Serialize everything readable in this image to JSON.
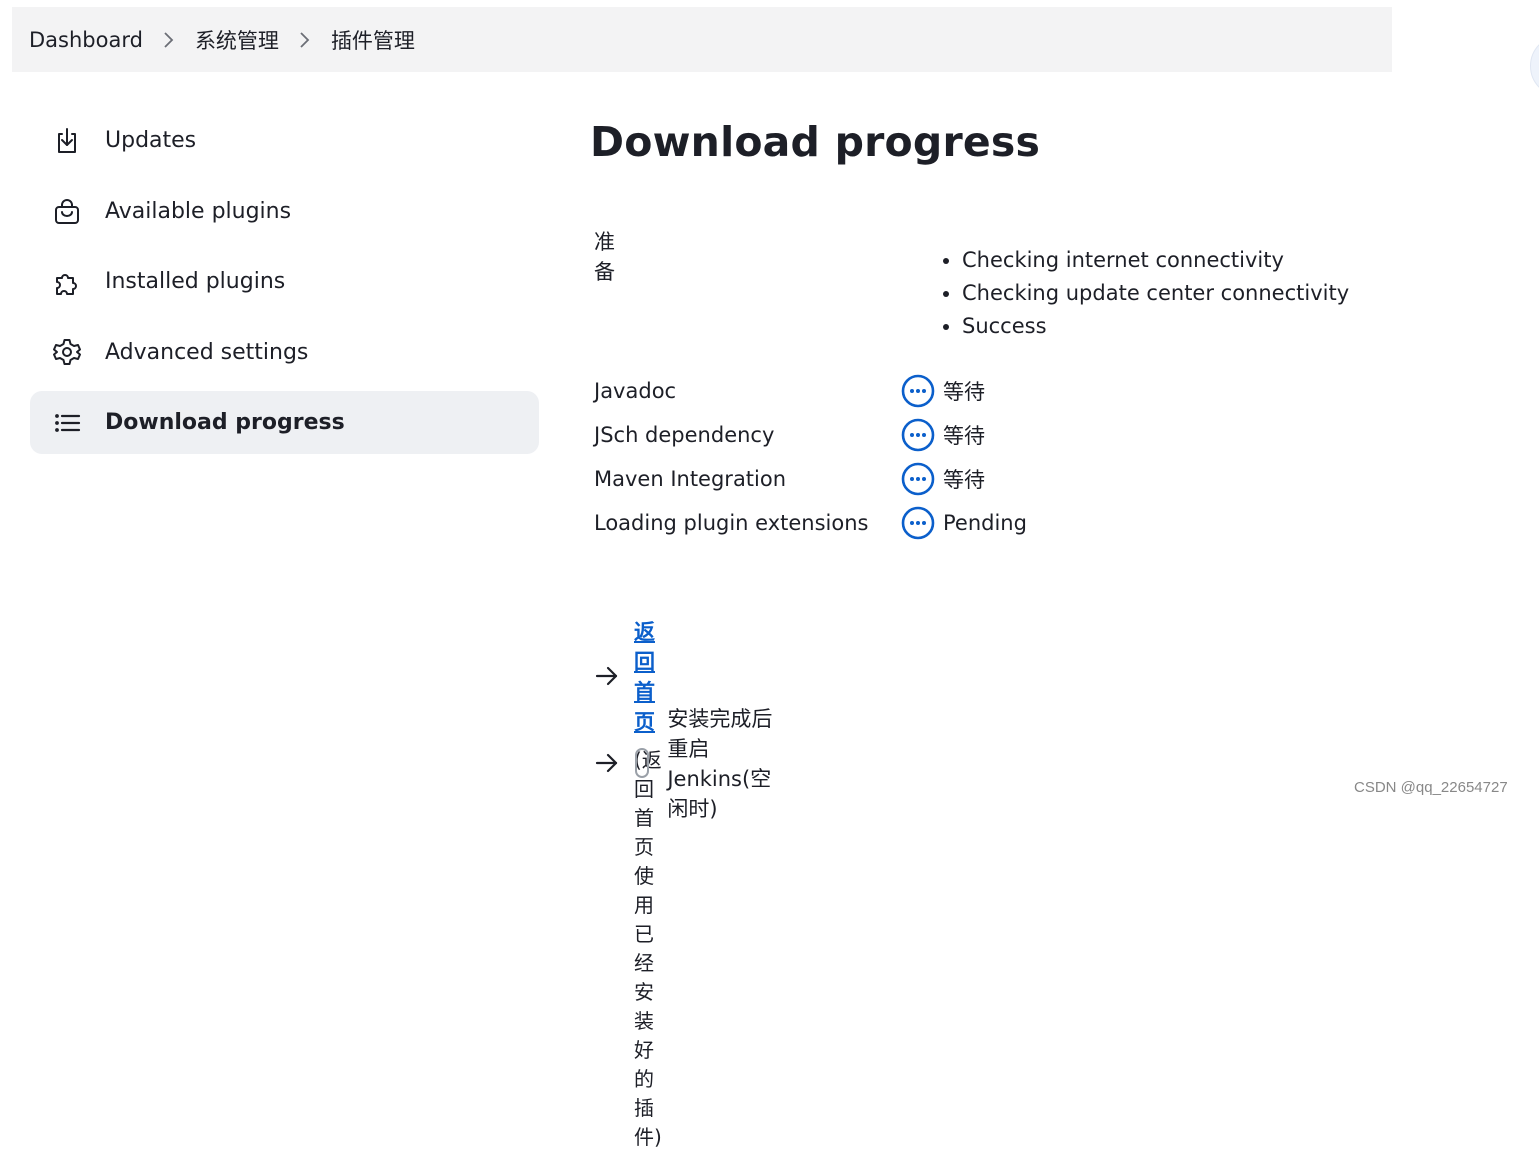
{
  "breadcrumb": {
    "items": [
      "Dashboard",
      "系统管理",
      "插件管理"
    ]
  },
  "sidebar": {
    "items": [
      {
        "label": "Updates",
        "icon": "download-icon",
        "active": false
      },
      {
        "label": "Available plugins",
        "icon": "shopping-bag-icon",
        "active": false
      },
      {
        "label": "Installed plugins",
        "icon": "puzzle-icon",
        "active": false
      },
      {
        "label": "Advanced settings",
        "icon": "gear-icon",
        "active": false
      },
      {
        "label": "Download progress",
        "icon": "list-icon",
        "active": true
      }
    ]
  },
  "main": {
    "title": "Download progress",
    "preparation": {
      "label": "准备",
      "steps": [
        "Checking internet connectivity",
        "Checking update center connectivity",
        "Success"
      ]
    },
    "plugins": [
      {
        "name": "Javadoc",
        "status": "等待",
        "status_icon": "pending-icon"
      },
      {
        "name": "JSch dependency",
        "status": "等待",
        "status_icon": "pending-icon"
      },
      {
        "name": "Maven Integration",
        "status": "等待",
        "status_icon": "pending-icon"
      },
      {
        "name": "Loading plugin extensions",
        "status": "Pending",
        "status_icon": "pending-icon"
      }
    ],
    "home_link": "返回首页",
    "home_description": "(返回首页使用已经安装好的插件)",
    "restart_label": "安装完成后重启Jenkins(空闲时)",
    "restart_checked": false
  },
  "watermark": "CSDN @qq_22654727",
  "colors": {
    "accent": "#0b5fcb",
    "active_bg": "#eef0f3",
    "breadcrumb_bg": "#f3f3f4"
  }
}
